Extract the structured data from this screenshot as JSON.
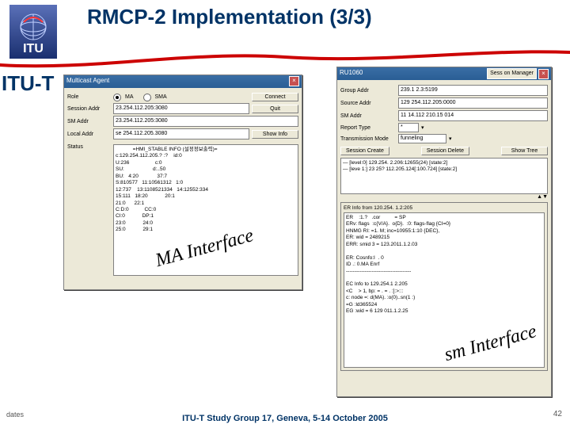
{
  "header": {
    "title": "RMCP-2 Implementation (3/3)",
    "org": "ITU-T"
  },
  "callouts": {
    "ma": "MA Interface",
    "sm": "sm Interface"
  },
  "footer": {
    "text": "ITU-T Study Group 17, Geneva, 5-14 October 2005",
    "dates": "dates",
    "page": "42"
  },
  "left_win": {
    "title": "Multicast Agent",
    "close": "×",
    "role_label": "Role",
    "role_ma": "MA",
    "role_sma": "SMA",
    "btn_connect": "Connect",
    "btn_quit": "Quit",
    "btn_showinfo": "Show Info",
    "session_addr_lbl": "Session Addr",
    "session_addr": "23.254.112.205:3080",
    "sm_addr_lbl": "SM Addr",
    "sm_addr": "23.254.112.205:3080",
    "local_addr_lbl": "Local Addr",
    "local_addr": "se 254.112.205.3080",
    "status_lbl": "Status",
    "status_text": "            =HMI_STABLE INFO (설정정보출력)=\nc:129.254.112.205.? :?    id:0\nU:236                  c:0\nSU:                    d:..50\nBU:   4:20             37:7\nS:810577   11:10561312   1:0\n12:737    13:1108521334   14:12552:334\n15:111   18:20            20:1\n21:0      22:1\nC:D:0           CC:0\nCI:0            DP:1\n23:0            24:0\n25:0            29:1"
  },
  "right_win": {
    "title": "RU1060",
    "sessmgr": "Sess on Manager",
    "close": "×",
    "group_addr_lbl": "Group Addr",
    "group_addr": "239.1 2.3:5199",
    "source_addr_lbl": "Source Addr",
    "source_addr": "129 254.112.205:0000",
    "sm_addr_lbl": "SM Addr",
    "sm_addr": "11 14.112 210.15 014",
    "report_type_lbl": "Report Type",
    "report_type": "*",
    "trans_mode_lbl": "Transmission Mode",
    "trans_mode": "funneling",
    "btn_create": "Session Create",
    "btn_delete": "Session Delete",
    "btn_showtree": "Show Tree",
    "tree_l1": "— [level:0] 129.254.     2.206:12655(24) [state:2]",
    "tree_l2": "   — [leve 1:] 23 25? 112.205.124[:100.724] [state:2]",
    "scroll": "▲▼",
    "info_header": "ER Info from 120.254.  1.2:205",
    "info_lines": "ER    :1.?   .cor          = SP\nERv: flags  :c{V/A}.  o{D}.  :0: flags-flag {CI=0}\nHNMG RI: =1. M; inc=10955:1:10 {DEC},\nER: wid = 2489215\nERR: smid 3 = 123.2011.1.2.03\n\nER: Cosnfo:I  . 0\nID .: 0.MA Enrf\n--------------------------------------\n\nEC Info to 129.254.1 2.205\n<C    > 1, bp: = . = . :]:>:::\nc: node =: d(MA). :o(0)..sn(1 :)\n=G :ld365524\nEG :wid = 6 129 011.1.2.25"
  }
}
